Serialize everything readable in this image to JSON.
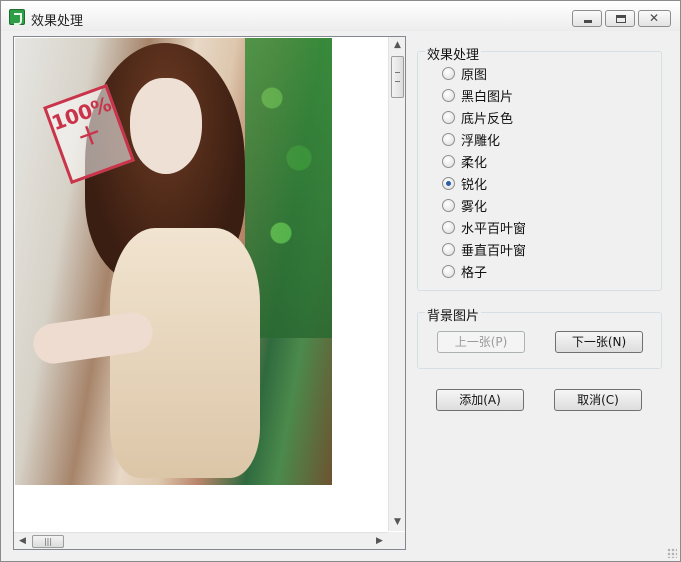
{
  "window": {
    "title": "效果处理"
  },
  "effects_group": {
    "title": "效果处理",
    "options": [
      {
        "label": "原图",
        "checked": false
      },
      {
        "label": "黑白图片",
        "checked": false
      },
      {
        "label": "底片反色",
        "checked": false
      },
      {
        "label": "浮雕化",
        "checked": false
      },
      {
        "label": "柔化",
        "checked": false
      },
      {
        "label": "锐化",
        "checked": true
      },
      {
        "label": "雾化",
        "checked": false
      },
      {
        "label": "水平百叶窗",
        "checked": false
      },
      {
        "label": "垂直百叶窗",
        "checked": false
      },
      {
        "label": "格子",
        "checked": false
      }
    ]
  },
  "background_group": {
    "title": "背景图片",
    "prev_label": "上一张(P)",
    "next_label": "下一张(N)"
  },
  "actions": {
    "add_label": "添加(A)",
    "cancel_label": "取消(C)"
  },
  "image_pane": {
    "vertical_scroll_fraction": 0.0,
    "horizontal_scroll_fraction": 0.0
  }
}
